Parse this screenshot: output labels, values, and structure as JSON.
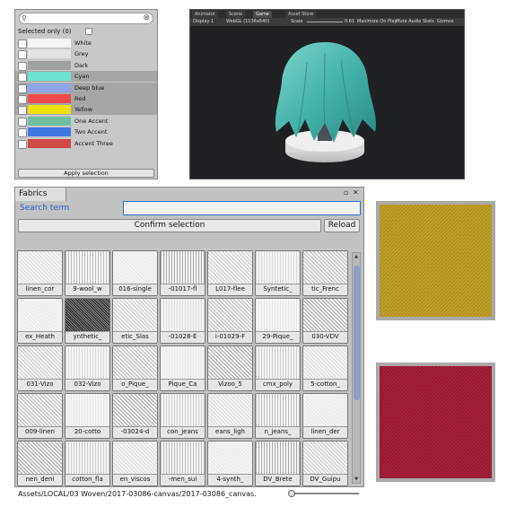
{
  "color_panel": {
    "selected_label": "Selected only (0)",
    "apply_label": "Apply selection",
    "rows": [
      {
        "label": "White",
        "color": "#f5f5f5",
        "highlighted": false
      },
      {
        "label": "Grey",
        "color": "#e2e2e2",
        "highlighted": false
      },
      {
        "label": "Dark",
        "color": "#a0a0a0",
        "highlighted": false
      },
      {
        "label": "Cyan",
        "color": "#6fe0cf",
        "highlighted": true
      },
      {
        "label": "Deep blue",
        "color": "#8ea6e6",
        "highlighted": true
      },
      {
        "label": "Red",
        "color": "#f04a4a",
        "highlighted": true
      },
      {
        "label": "Yellow",
        "color": "#f0e010",
        "highlighted": true
      },
      {
        "label": "One Accent",
        "color": "#6fbfa0",
        "highlighted": false
      },
      {
        "label": "Two Accent",
        "color": "#3f78e0",
        "highlighted": false
      },
      {
        "label": "Accent Three",
        "color": "#d04848",
        "highlighted": false
      }
    ]
  },
  "scene": {
    "tabs": [
      "Animator",
      "Scene",
      "Game",
      "Asset Store"
    ],
    "active_tab": "Game",
    "bar": {
      "display": "Display 1",
      "resolution": "WebGL (1136x640)",
      "scale_label": "Scale",
      "scale_value": "0.61",
      "maximize": "Maximize On Play",
      "mute": "Mute Audio",
      "stats": "Stats",
      "gizmos": "Gizmos"
    }
  },
  "fabrics": {
    "tab_label": "Fabrics",
    "search_label": "Search term",
    "search_value": "",
    "confirm_label": "Confirm selection",
    "reload_label": "Reload",
    "path": "Assets/LOCAL/03 Woven/2017-03086-canvas/2017-03086_canvas.",
    "thumbs": [
      [
        "linen_cor",
        "9-wool_w",
        "016-single",
        "-01017-fl",
        "L017-flee",
        "Syntetic_",
        "tic_Frenc"
      ],
      [
        "ex_Heath",
        "ynthetic_",
        "etic_Slas",
        "-01028-E",
        "i-01029-F",
        "29-Pique_",
        "030-VDV"
      ],
      [
        "031-Vizo",
        "032-Vizo",
        "o_Pique_",
        "Pique_Ca",
        "Vizoo_5",
        "cmx_poly",
        "5-cotton_"
      ],
      [
        "009-linen",
        "20-cotto",
        "-03024-d",
        "con_jeans",
        "eans_ligh",
        "n_jeans_",
        "linen_der"
      ],
      [
        "nen_deni",
        "cotton_fla",
        "en_viscos",
        "-men_sui",
        "4-synth_",
        "DV_Brete",
        "DV_Guipu"
      ]
    ]
  },
  "swatches": {
    "gold": "#c2a02a",
    "red": "#a8203a"
  }
}
